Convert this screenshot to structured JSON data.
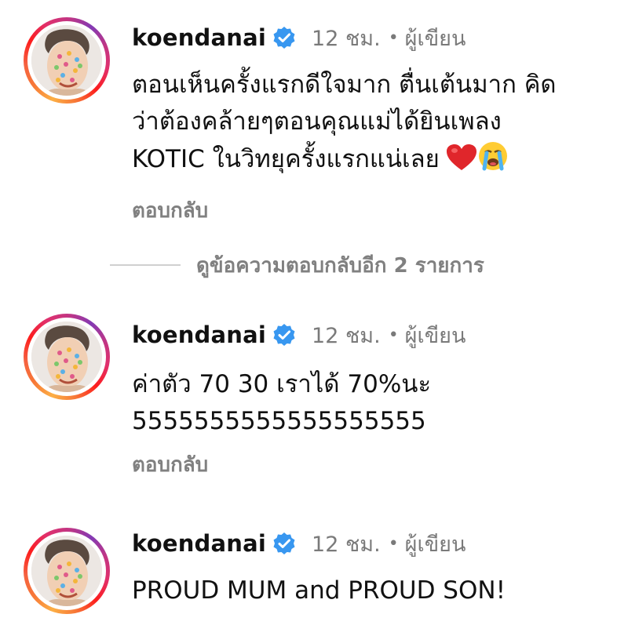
{
  "comments": [
    {
      "username": "koendanai",
      "time": "12 ชม.",
      "separator": "•",
      "author_badge": "ผู้เขียน",
      "lines": [
        "ตอนเห็นครั้งแรกดีใจมาก ตื่นเต้นมาก คิด",
        "ว่าต้องคล้ายๆตอนคุณแม่ได้ยินเพลง",
        "KOTIC ในวิทยุครั้งแรกแน่เลย"
      ],
      "emojis": [
        "red-heart",
        "loudly-crying-face"
      ],
      "reply_label": "ตอบกลับ"
    },
    {
      "username": "koendanai",
      "time": "12 ชม.",
      "separator": "•",
      "author_badge": "ผู้เขียน",
      "lines": [
        "ค่าตัว 70 30 เราได้ 70%นะ",
        "5555555555555555555"
      ],
      "reply_label": "ตอบกลับ"
    },
    {
      "username": "koendanai",
      "time": "12 ชม.",
      "separator": "•",
      "author_badge": "ผู้เขียน",
      "lines": [
        "PROUD MUM and PROUD SON!"
      ]
    }
  ],
  "view_replies": {
    "label": "ดูข้อความตอบกลับอีก 2 รายการ"
  },
  "colors": {
    "verified_badge": "#3897f0",
    "secondary_text": "#7a7a7a",
    "story_ring_start": "#fcaf45",
    "story_ring_end": "#833ab4"
  }
}
